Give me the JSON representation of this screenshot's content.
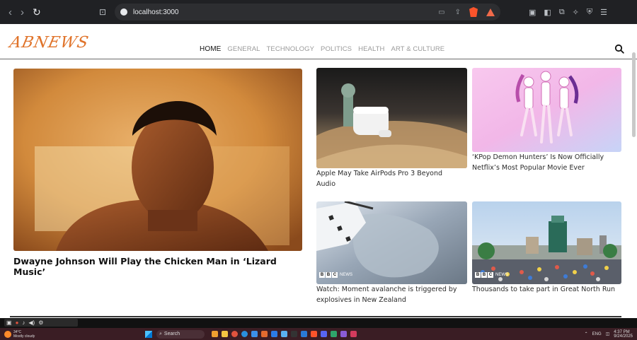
{
  "browser": {
    "back_icon": "chevron-left-icon",
    "forward_icon": "chevron-right-icon",
    "reload_icon": "reload-icon",
    "url": "localhost:3000"
  },
  "site": {
    "logo": "ABNEWS",
    "menu": [
      {
        "label": "HOME",
        "active": true
      },
      {
        "label": "GENERAL",
        "active": false
      },
      {
        "label": "TECHNOLOGY",
        "active": false
      },
      {
        "label": "POLITICS",
        "active": false
      },
      {
        "label": "HEALTH",
        "active": false
      },
      {
        "label": "ART & CULTURE",
        "active": false
      }
    ]
  },
  "articles": {
    "featured": {
      "title": "Dwayne Johnson Will Play the Chicken Man in ‘Lizard Music’"
    },
    "airpods": {
      "title": "Apple May Take AirPods Pro 3 Beyond Audio"
    },
    "kpop": {
      "title": "‘KPop Demon Hunters’ Is Now Officially Netflix’s Most Popular Movie Ever"
    },
    "avalanche": {
      "title": "Watch: Moment avalanche is triggered by explosives in New Zealand",
      "badge": "NEWS"
    },
    "run": {
      "title": "Thousands to take part in Great North Run",
      "badge": "NEWS"
    }
  },
  "taskbar": {
    "weather_temp": "34°C",
    "weather_desc": "Mostly cloudy",
    "search_label": "Search",
    "lang": "ENG",
    "time": "4:37 PM",
    "date": "9/24/2025"
  },
  "colors": {
    "logo": "#e0732a",
    "brand_brave": "#fb542b",
    "taskbar": "#3a1d24"
  }
}
